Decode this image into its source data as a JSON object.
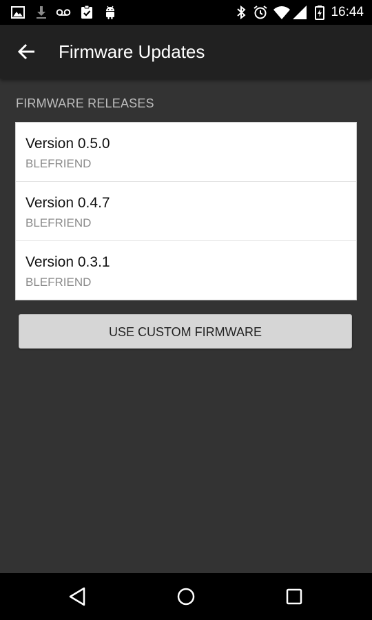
{
  "status_bar": {
    "time": "16:44",
    "left_icons": [
      "image-icon",
      "download-icon",
      "voicemail-icon",
      "clipboard-check-icon",
      "android-icon"
    ],
    "right_icons": [
      "bluetooth-icon",
      "alarm-icon",
      "wifi-icon",
      "signal-icon",
      "battery-icon"
    ]
  },
  "app_bar": {
    "title": "Firmware Updates",
    "back_icon": "arrow-back-icon"
  },
  "releases": {
    "header": "FIRMWARE RELEASES",
    "items": [
      {
        "version": "Version 0.5.0",
        "device": "BLEFRIEND"
      },
      {
        "version": "Version 0.4.7",
        "device": "BLEFRIEND"
      },
      {
        "version": "Version 0.3.1",
        "device": "BLEFRIEND"
      }
    ]
  },
  "custom_button": {
    "label": "USE CUSTOM FIRMWARE"
  },
  "nav_bar": {
    "buttons": [
      "back-triangle-icon",
      "home-circle-icon",
      "recents-square-icon"
    ]
  },
  "colors": {
    "background": "#333333",
    "app_bar": "#212121",
    "status_bar": "#000000",
    "list_bg": "#ffffff",
    "button_bg": "#d6d6d6"
  }
}
